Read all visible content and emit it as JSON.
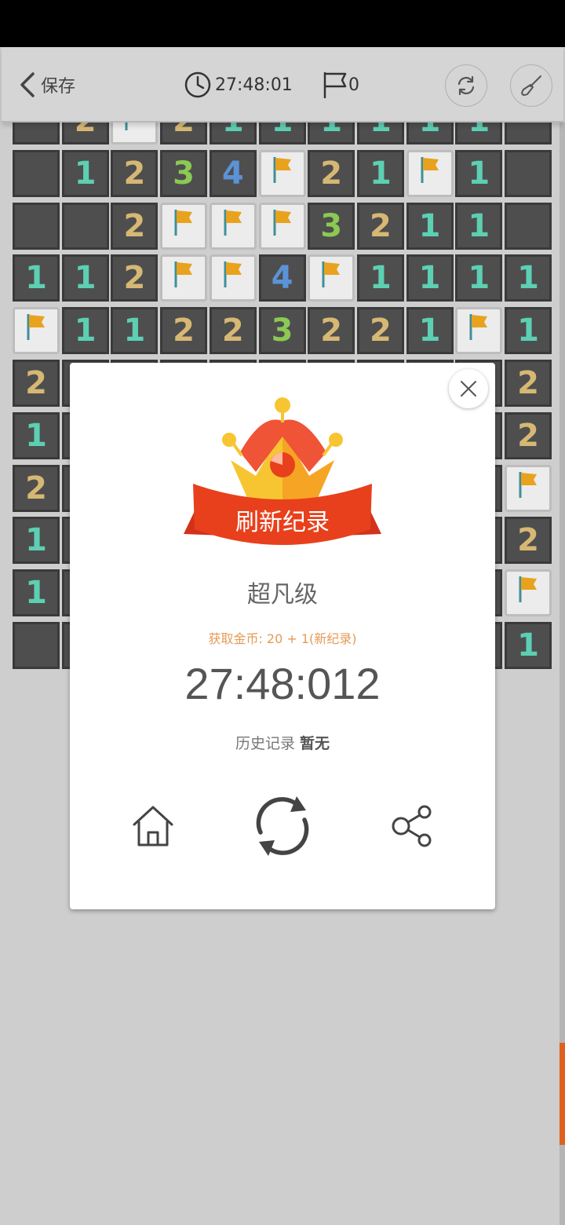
{
  "header": {
    "back_label": "保存",
    "timer": "27:48:01",
    "flag_count": "0",
    "icons": [
      "back-chevron-icon",
      "clock-icon",
      "flag-icon",
      "refresh-icon",
      "brush-icon"
    ]
  },
  "board": {
    "rows": [
      [
        "",
        "2",
        "F",
        "2",
        "1",
        "1",
        "1",
        "1",
        "1",
        "1",
        ""
      ],
      [
        "",
        "1",
        "2",
        "3",
        "4",
        "F",
        "2",
        "1",
        "F",
        "1",
        ""
      ],
      [
        "",
        "",
        "2",
        "F",
        "F",
        "F",
        "3",
        "2",
        "1",
        "1",
        ""
      ],
      [
        "1",
        "1",
        "2",
        "F",
        "F",
        "4",
        "F",
        "1",
        "1",
        "1",
        "1"
      ],
      [
        "F",
        "1",
        "1",
        "2",
        "2",
        "3",
        "2",
        "2",
        "1",
        "F",
        "1"
      ],
      [
        "2",
        "",
        "",
        "",
        "",
        "",
        "",
        "",
        "",
        "",
        "2"
      ],
      [
        "1",
        "",
        "",
        "",
        "",
        "",
        "",
        "",
        "",
        "",
        "2"
      ],
      [
        "2",
        "",
        "",
        "",
        "",
        "",
        "",
        "",
        "",
        "",
        "F"
      ],
      [
        "1",
        "",
        "",
        "",
        "",
        "",
        "",
        "",
        "",
        "",
        "2"
      ],
      [
        "1",
        "",
        "",
        "",
        "",
        "",
        "",
        "",
        "",
        "",
        "F"
      ],
      [
        "",
        "",
        "",
        "",
        "",
        "",
        "",
        "",
        "",
        "",
        "1"
      ]
    ]
  },
  "dialog": {
    "banner_text": "刷新纪录",
    "level": "超凡级",
    "coins_text": "获取金币: 20 + 1(新纪录)",
    "score": "27:48:012",
    "history_label": "历史记录",
    "history_value": "暂无",
    "actions": [
      "home-icon",
      "replay-icon",
      "share-icon"
    ]
  },
  "colors": {
    "n1": "#5dcfb3",
    "n2": "#d6b874",
    "n3": "#8bc954",
    "n4": "#5b93d8",
    "banner": "#e8401c",
    "crown_gold": "#f7c531",
    "coins_text": "#e59a56"
  }
}
